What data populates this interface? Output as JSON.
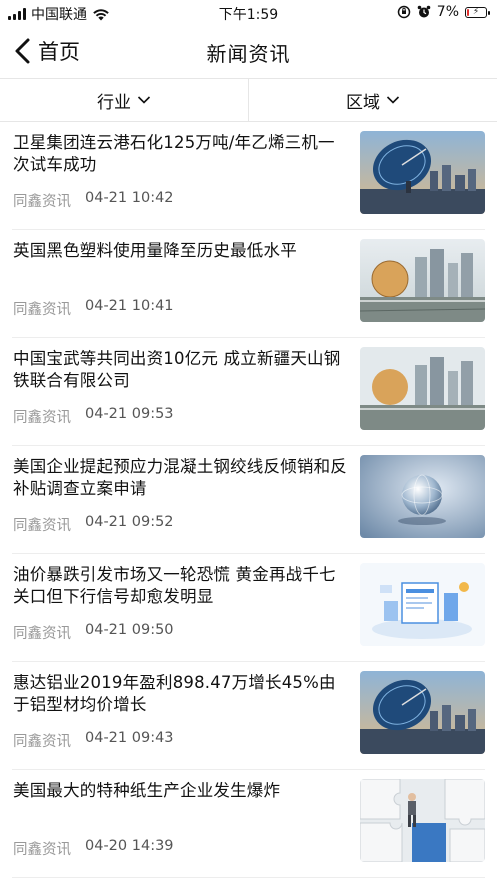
{
  "status_bar": {
    "carrier": "中国联通",
    "time": "下午1:59",
    "battery": "7%"
  },
  "nav": {
    "back_label": "首页",
    "title": "新闻资讯"
  },
  "filters": [
    {
      "label": "行业"
    },
    {
      "label": "区域"
    }
  ],
  "news": [
    {
      "title": "卫星集团连云港石化125万吨/年乙烯三机一次试车成功",
      "source": "同鑫资讯",
      "time": "04-21 10:42",
      "thumb": "satellite-dish"
    },
    {
      "title": "英国黑色塑料使用量降至历史最低水平",
      "source": "同鑫资讯",
      "time": "04-21 10:41",
      "thumb": "city-skyline"
    },
    {
      "title": "中国宝武等共同出资10亿元 成立新疆天山钢铁联合有限公司",
      "source": "同鑫资讯",
      "time": "04-21 09:53",
      "thumb": "city-skyline"
    },
    {
      "title": "美国企业提起预应力混凝土钢绞线反倾销和反补贴调查立案申请",
      "source": "同鑫资讯",
      "time": "04-21 09:52",
      "thumb": "glass-globe"
    },
    {
      "title": "油价暴跌引发市场又一轮恐慌 黄金再战千七关口但下行信号却愈发明显",
      "source": "同鑫资讯",
      "time": "04-21 09:50",
      "thumb": "news-illustration"
    },
    {
      "title": "惠达铝业2019年盈利898.47万增长45%由于铝型材均价增长",
      "source": "同鑫资讯",
      "time": "04-21 09:43",
      "thumb": "satellite-dish"
    },
    {
      "title": "美国最大的特种纸生产企业发生爆炸",
      "source": "同鑫资讯",
      "time": "04-20 14:39",
      "thumb": "puzzle-figure"
    }
  ]
}
